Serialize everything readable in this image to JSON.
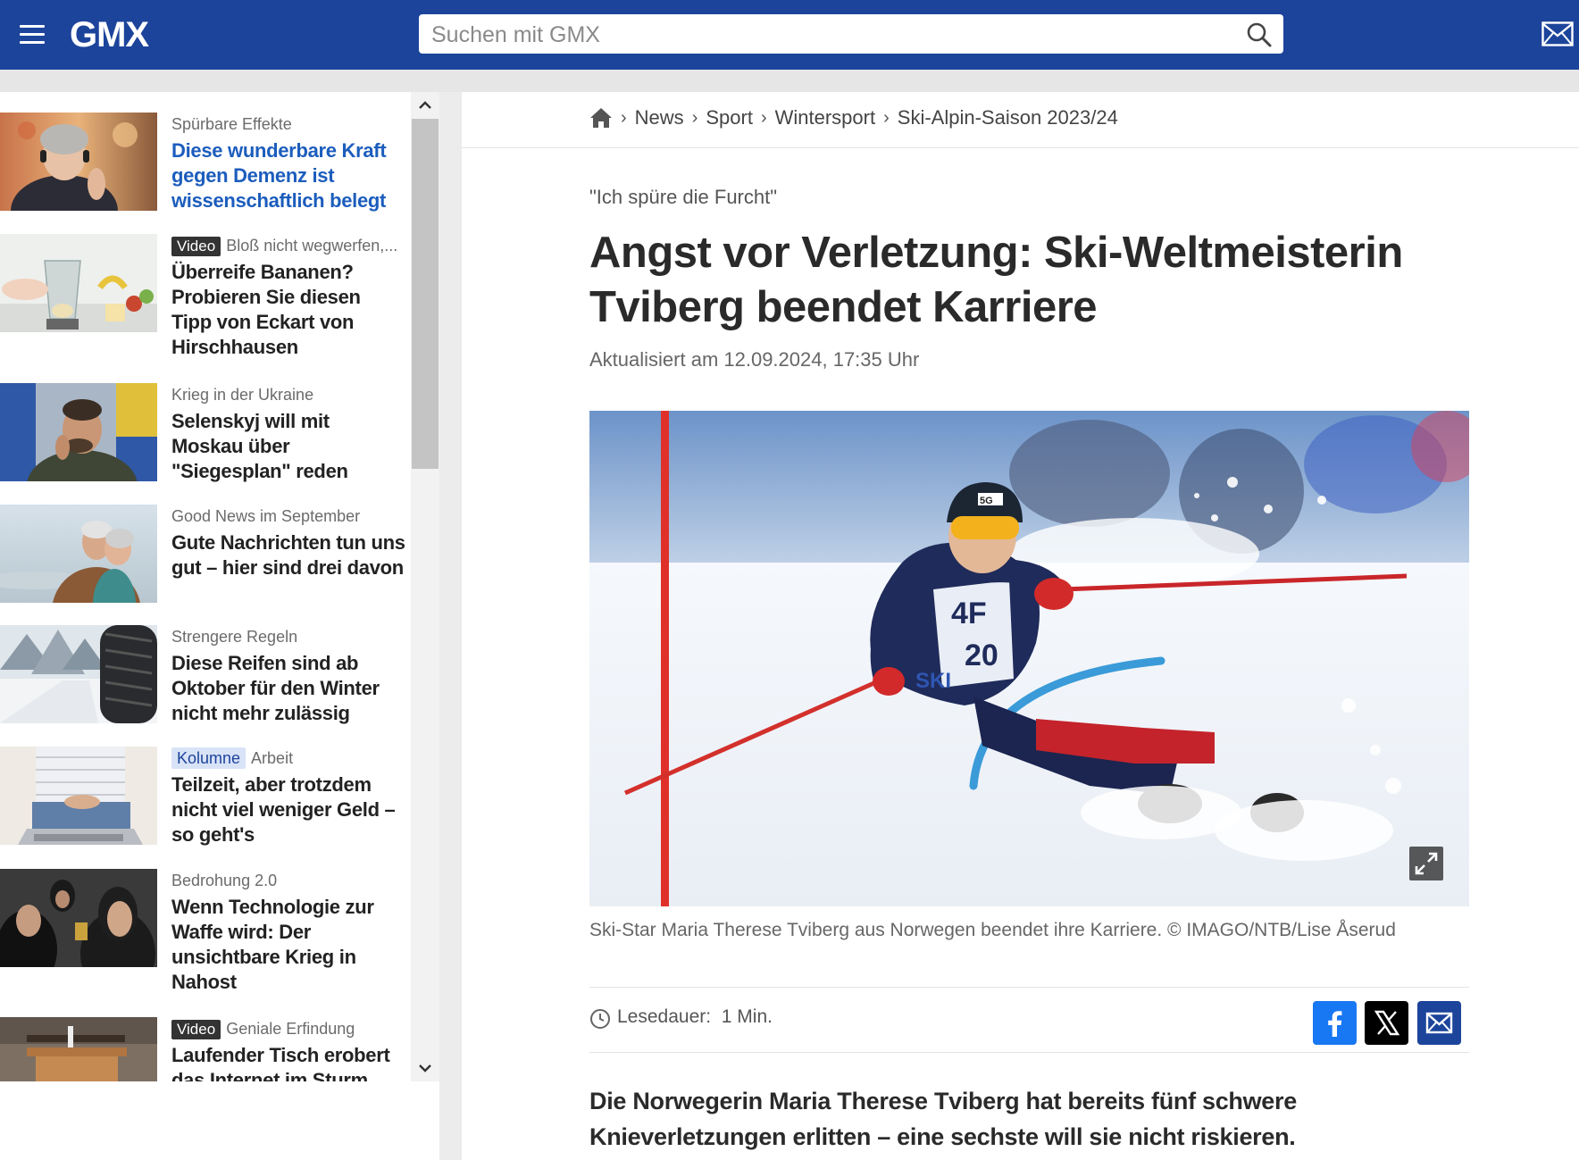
{
  "header": {
    "logo": "GMX",
    "search_placeholder": "Suchen mit GMX",
    "brand_color": "#1c449b"
  },
  "sidebar": {
    "items": [
      {
        "kicker": "Spürbare Effekte",
        "headline": "Diese wunderbare Kraft gegen Demenz ist wissenschaftlich belegt",
        "highlight": true
      },
      {
        "badge": "Video",
        "kicker": "Bloß nicht wegwerfen,...",
        "headline": "Überreife Bananen? Probieren Sie diesen Tipp von Eckart von Hirschhausen"
      },
      {
        "kicker": "Krieg in der Ukraine",
        "headline": "Selenskyj will mit Moskau über \"Siegesplan\" reden"
      },
      {
        "kicker": "Good News im September",
        "headline": "Gute Nachrichten tun uns gut – hier sind drei davon"
      },
      {
        "kicker": "Strengere Regeln",
        "headline": "Diese Reifen sind ab Oktober für den Winter nicht mehr zulässig"
      },
      {
        "badge": "Kolumne",
        "kicker": "Arbeit",
        "headline": "Teilzeit, aber trotzdem nicht viel weniger Geld – so geht's"
      },
      {
        "kicker": "Bedrohung 2.0",
        "headline": "Wenn Technologie zur Waffe wird: Der unsichtbare Krieg in Nahost"
      },
      {
        "badge": "Video",
        "kicker": "Geniale Erfindung",
        "headline": "Laufender Tisch erobert das Internet im Sturm"
      }
    ]
  },
  "breadcrumb": [
    "News",
    "Sport",
    "Wintersport",
    "Ski-Alpin-Saison 2023/24"
  ],
  "article": {
    "kicker": "\"Ich spüre die Furcht\"",
    "title": "Angst vor Verletzung: Ski-Weltmeisterin Tviberg beendet Karriere",
    "updated": "Aktualisiert am 12.09.2024, 17:35 Uhr",
    "caption": "Ski-Star Maria Therese Tviberg aus Norwegen beendet ihre Karriere. © IMAGO/NTB/Lise Åserud",
    "readtime_label": "Lesedauer:",
    "readtime_value": "1 Min.",
    "lead": "Die Norwegerin Maria Therese Tviberg hat bereits fünf schwere Knieverletzungen erlitten – eine sechste will sie nicht riskieren."
  },
  "hero_image_text": {
    "helmet": "5G",
    "bib_brand": "4F",
    "bib_number": "20",
    "bib_event": "SKI"
  },
  "share_icons": [
    "facebook-icon",
    "x-icon",
    "mail-icon"
  ]
}
